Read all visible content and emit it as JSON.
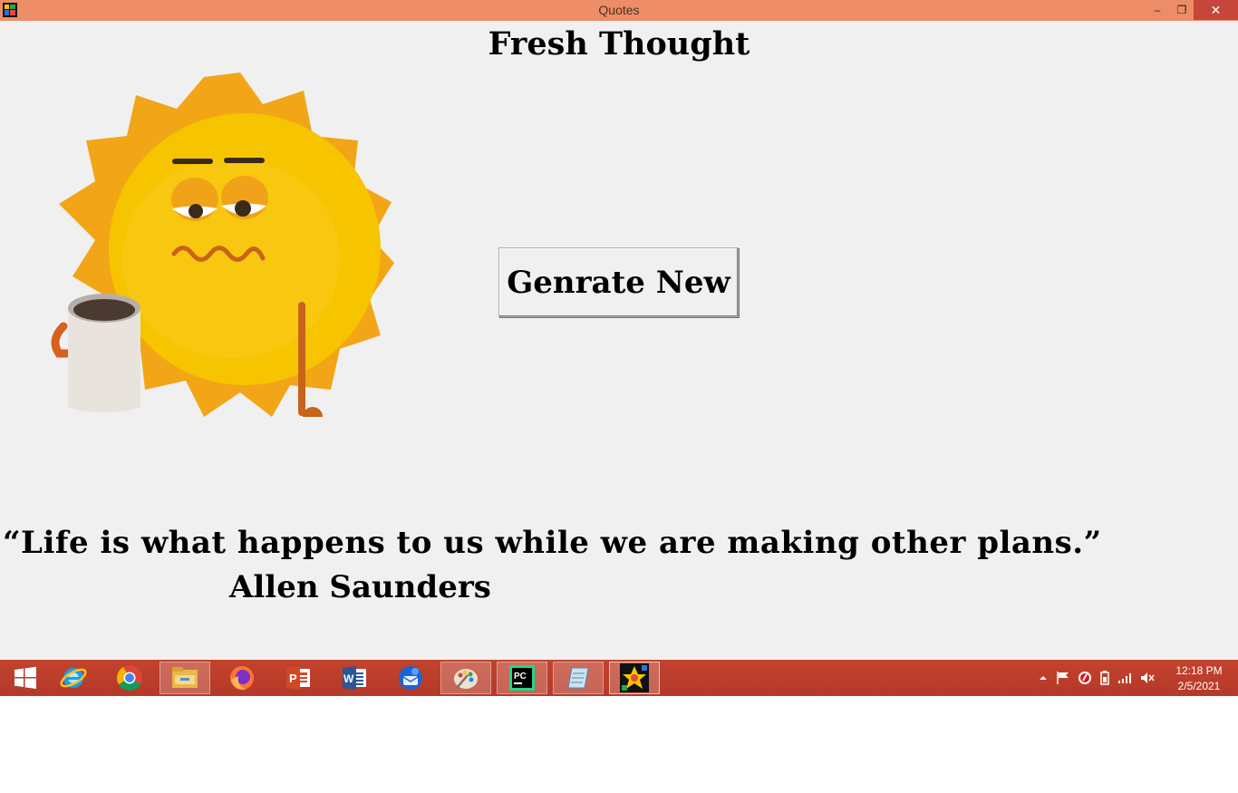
{
  "window": {
    "title": "Quotes",
    "minimize_glyph": "–",
    "maximize_glyph": "❐",
    "close_glyph": "✕"
  },
  "app": {
    "heading": "Fresh Thought",
    "generate_button": "Genrate New",
    "quote": "“Life is what happens to us while we are making other plans.”",
    "author": "Allen Saunders",
    "image": "sleepy-sun-with-coffee-illustration"
  },
  "taskbar": {
    "items": [
      "start-icon",
      "internet-explorer-icon",
      "chrome-icon",
      "file-explorer-icon",
      "firefox-icon",
      "powerpoint-icon",
      "word-icon",
      "thunderbird-icon",
      "paint-icon",
      "pycharm-icon",
      "notepad-icon",
      "quotes-app-icon"
    ],
    "clock_time": "12:18 PM",
    "clock_date": "2/5/2021"
  },
  "colors": {
    "titlebar": "#ec8d67",
    "close": "#c7463a",
    "taskbar": "#b93c2b",
    "client_bg": "#f0f0f0",
    "sun_outer": "#f2a516",
    "sun_inner": "#f7c400"
  }
}
